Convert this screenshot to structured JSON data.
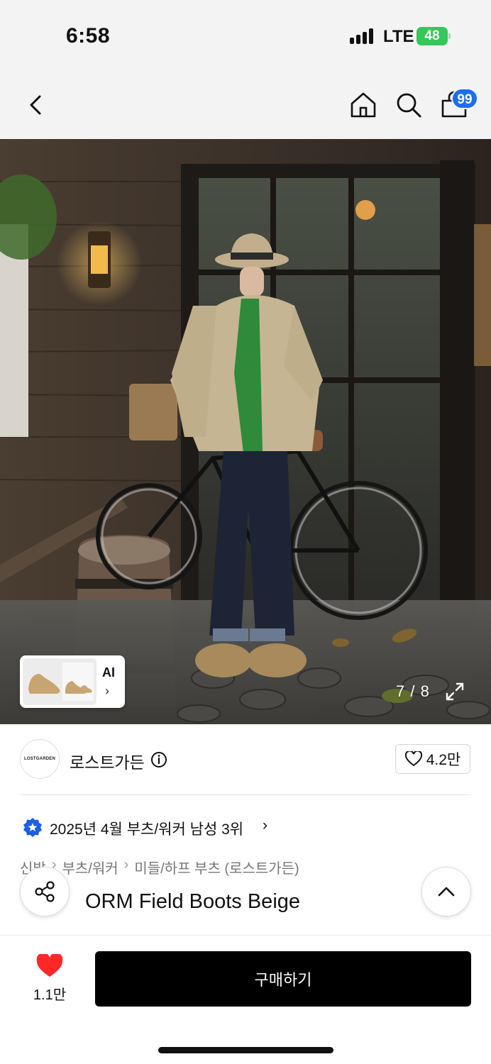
{
  "status_bar": {
    "time": "6:58",
    "network": "LTE",
    "battery": "48"
  },
  "nav": {
    "back_icon": "chevron-left-icon",
    "home_icon": "home-icon",
    "search_icon": "search-icon",
    "bag_icon": "shopping-bag-icon",
    "cart_count": "99",
    "badge_color": "#1f6cf2"
  },
  "gallery": {
    "ai_label": "AI",
    "ai_chevron": "›",
    "current": "7",
    "separator": "/",
    "total": "8",
    "expand_icon": "expand-icon"
  },
  "brand": {
    "logo_text": "LOSTGARDEN",
    "name": "로스트가든",
    "likes": "4.2만"
  },
  "ranking": {
    "text": "2025년 4월 부츠/워커 남성 3위",
    "chevron": "›"
  },
  "breadcrumb": [
    "신발",
    "부츠/워커",
    "미들/하프 부츠 (로스트가든)"
  ],
  "breadcrumb_sep": "›",
  "product": {
    "title": "ORM Field Boots Beige"
  },
  "bottom": {
    "wish_count": "1.1만",
    "buy_label": "구매하기",
    "heart_color": "#ff2727"
  }
}
